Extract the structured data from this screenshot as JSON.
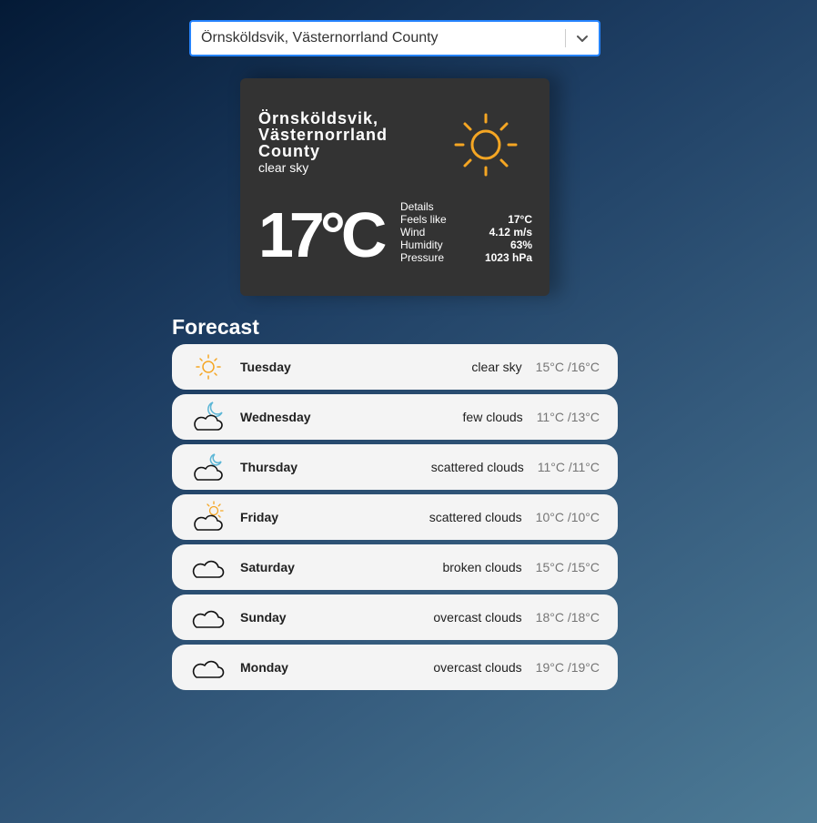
{
  "search": {
    "value": "Örnsköldsvik, Västernorrland County"
  },
  "current": {
    "city": "Örnsköldsvik, Västernorrland County",
    "description": "clear sky",
    "icon": "sun-icon",
    "temperature": "17°C",
    "details_label": "Details",
    "details": [
      {
        "label": "Feels like",
        "value": "17°C"
      },
      {
        "label": "Wind",
        "value": "4.12 m/s"
      },
      {
        "label": "Humidity",
        "value": "63%"
      },
      {
        "label": "Pressure",
        "value": "1023 hPa"
      }
    ]
  },
  "forecast": {
    "title": "Forecast",
    "items": [
      {
        "day": "Tuesday",
        "description": "clear sky",
        "minmax": "15°C /16°C",
        "icon": "sun-icon"
      },
      {
        "day": "Wednesday",
        "description": "few clouds",
        "minmax": "11°C /13°C",
        "icon": "cloud-moon-icon"
      },
      {
        "day": "Thursday",
        "description": "scattered clouds",
        "minmax": "11°C /11°C",
        "icon": "cloud-moon-icon"
      },
      {
        "day": "Friday",
        "description": "scattered clouds",
        "minmax": "10°C /10°C",
        "icon": "cloud-sun-icon"
      },
      {
        "day": "Saturday",
        "description": "broken clouds",
        "minmax": "15°C /15°C",
        "icon": "cloud-icon"
      },
      {
        "day": "Sunday",
        "description": "overcast clouds",
        "minmax": "18°C /18°C",
        "icon": "cloud-icon"
      },
      {
        "day": "Monday",
        "description": "overcast clouds",
        "minmax": "19°C /19°C",
        "icon": "cloud-icon"
      }
    ]
  },
  "colors": {
    "accent_border": "#2684ff",
    "sun": "#f5a623",
    "moon": "#5bb6d6",
    "card_bg": "#333333",
    "item_bg": "#f4f4f4"
  }
}
